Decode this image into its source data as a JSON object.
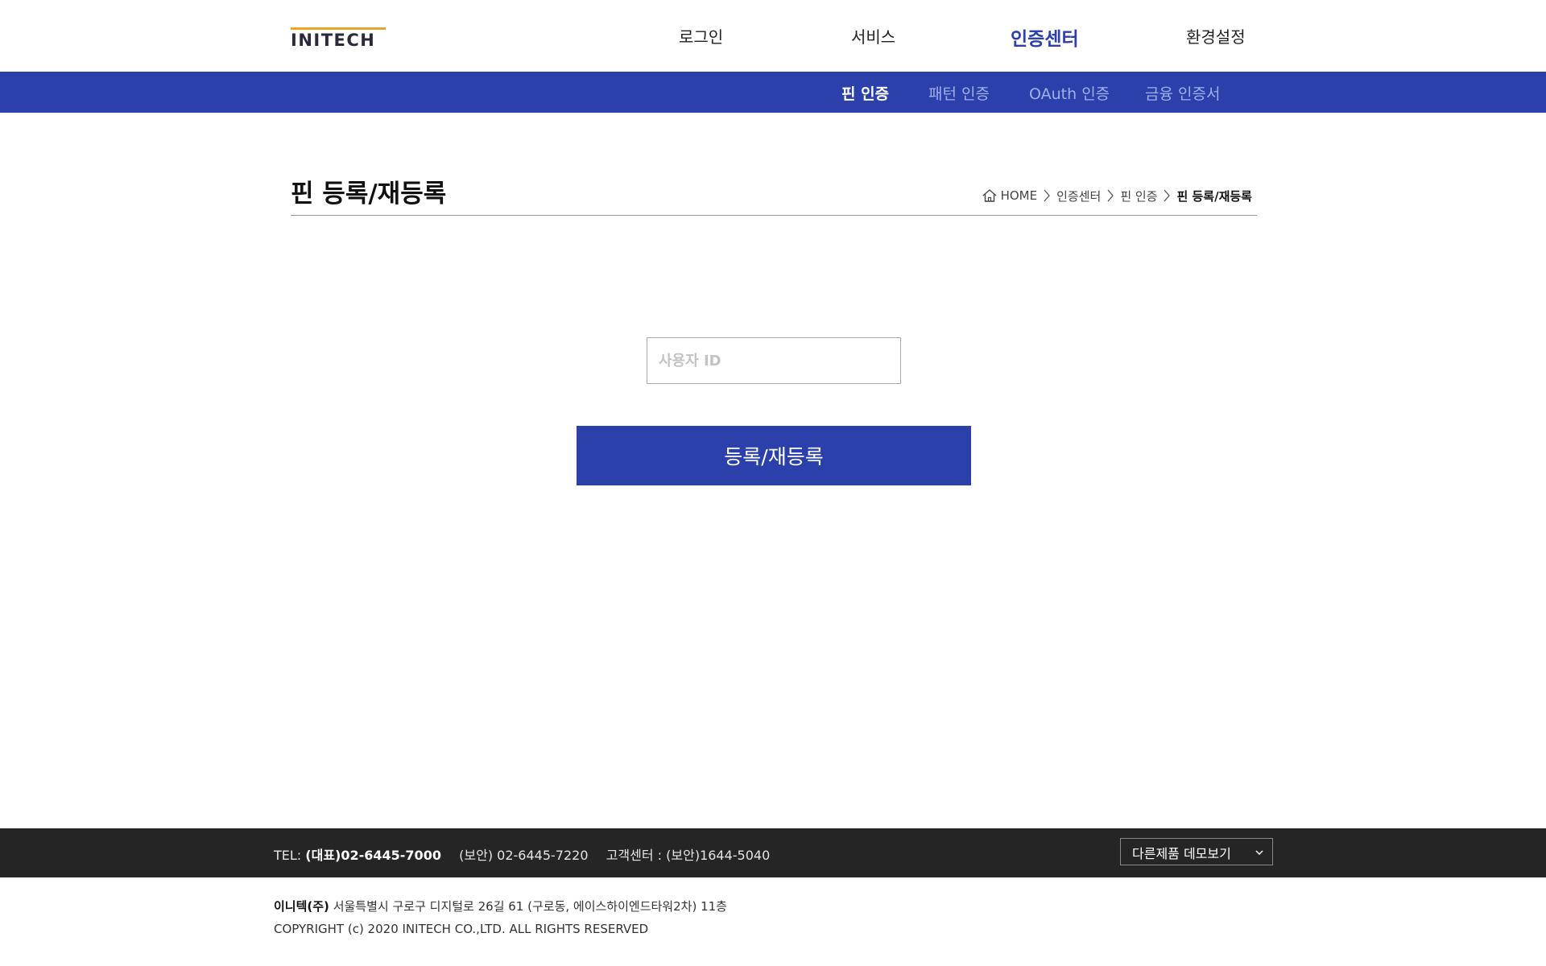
{
  "brand": {
    "logo_text": "INITECH"
  },
  "gnb": {
    "items": [
      {
        "label": "로그인"
      },
      {
        "label": "서비스"
      },
      {
        "label": "인증센터"
      },
      {
        "label": "환경설정"
      }
    ]
  },
  "subnav": {
    "items": [
      {
        "label": "핀 인증"
      },
      {
        "label": "패턴 인증"
      },
      {
        "label": "OAuth 인증"
      },
      {
        "label": "금융 인증서"
      }
    ]
  },
  "page": {
    "title": "핀 등록/재등록",
    "breadcrumb": [
      "HOME",
      "인증센터",
      "핀 인증",
      "핀 등록/재등록"
    ]
  },
  "form": {
    "user_id_placeholder": "사용자 ID",
    "user_id_value": "",
    "submit_label": "등록/재등록"
  },
  "footer": {
    "tel_label": "TEL:",
    "tel_main": "(대표)02-6445-7000",
    "tel_security": "(보안) 02-6445-7220",
    "customer_center": "고객센터 : (보안)1644-5040",
    "demo_select": "다른제품 데모보기",
    "company_name": "이니텍(주)",
    "address": "서울특별시 구로구 디지털로 26길 61 (구로동, 에이스하이엔드타워2차) 11층",
    "copyright": "COPYRIGHT (c) 2020 INITECH CO.,LTD. ALL RIGHTS RESERVED"
  }
}
